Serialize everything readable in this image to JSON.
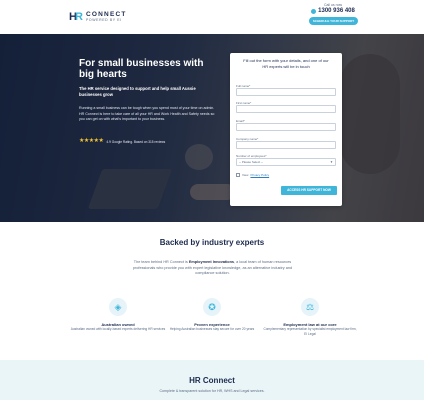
{
  "header": {
    "logo_name": "CONNECT",
    "logo_mark_h": "H",
    "logo_mark_r": "R",
    "logo_tagline": "POWERED BY EI",
    "phone_label": "Call us now",
    "phone_number": "1300 936 408",
    "cta_label": "SCHEDULE YOUR SUPPORT NOW"
  },
  "hero": {
    "title": "For small businesses with big hearts",
    "subtitle": "The HR service designed to support and help small Aussie businesses grow",
    "body": "Running a small business can be tough when you spend most of your time on admin. HR Connect is here to take care of all your HR and Work Health and Safety needs so you can get on with what's important to your business.",
    "stars": "★★★★★",
    "rating_text": "4.9 Google Rating. Based on 315 reviews"
  },
  "form": {
    "heading": "Fill out the form with your details, and one of our HR experts will be in touch",
    "fields": [
      {
        "label": "Full name*"
      },
      {
        "label": "First name*"
      },
      {
        "label": "Email*"
      },
      {
        "label": "Company name*"
      }
    ],
    "employees_label": "Number of employees*",
    "employees_selected": "-- Please Select --",
    "privacy_prefix": "View",
    "privacy_link": "Privacy Policy",
    "submit_label": "ACCESS HR SUPPORT NOW"
  },
  "experts": {
    "title": "Backed by industry experts",
    "text_before": "The team behind HR Connect is",
    "text_highlight": "Employment Innovations",
    "text_after": ", a local team of human resources professionals who provide you with expert legislative knowledge, as an alternative industry and compliance solution.",
    "features": [
      {
        "icon": "australia-map-icon",
        "glyph": "◈",
        "title": "Australian owned",
        "text": "Australian owned with locally-based experts delivering HR services"
      },
      {
        "icon": "award-icon",
        "glyph": "✪",
        "title": "Proven experience",
        "text": "Helping Australian businesses stay secure for over 20 years"
      },
      {
        "icon": "legal-scale-icon",
        "glyph": "⚖",
        "title": "Employment law at our core",
        "text": "Complementary representation by specialist employment law firm, EI Legal"
      }
    ]
  },
  "footer": {
    "title": "HR Connect",
    "subtitle": "Complete & transparent solution for HR, WHS and Legal services."
  },
  "colors": {
    "accent": "#3fb6d9",
    "navy": "#1d2b4f",
    "star": "#f2c230",
    "footer_band": "#eaf5f7"
  }
}
